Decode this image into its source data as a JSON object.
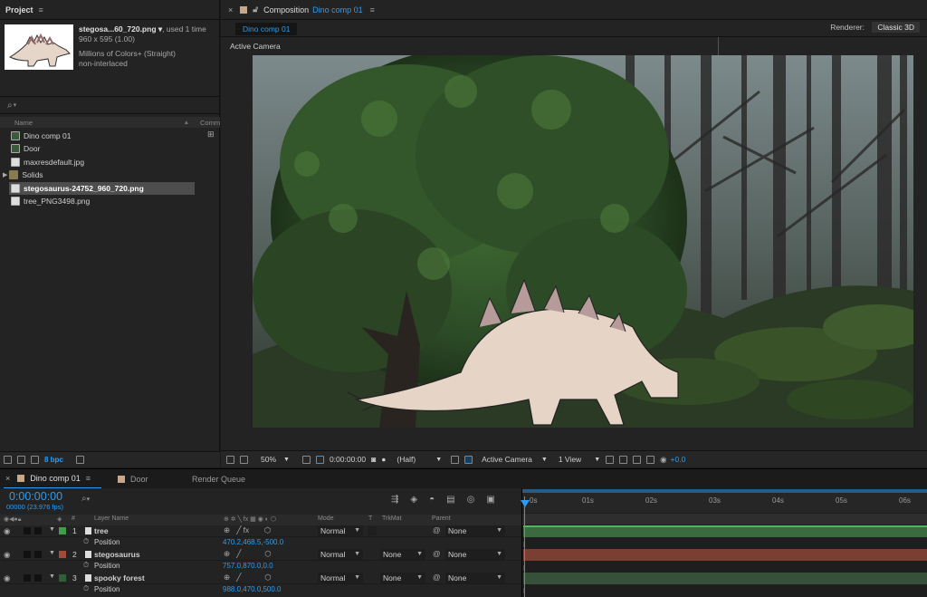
{
  "project": {
    "tab_label": "Project",
    "menu_icon": "≡",
    "file_name": "stegosa...60_720.png ▾",
    "file_used": ", used 1 time",
    "file_dims": "960 x 595 (1.00)",
    "file_colors": "Millions of Colors+ (Straight)",
    "file_interlace": "non-interlaced",
    "search_icon": "⌕",
    "col_name": "Name",
    "col_comment": "Comm",
    "items": [
      {
        "label": "Dino comp 01",
        "icon": "composition-icon"
      },
      {
        "label": "Door",
        "icon": "file-icon"
      },
      {
        "label": "maxresdefault.jpg",
        "icon": "file-icon"
      },
      {
        "label": "Solids",
        "icon": "folder-icon"
      },
      {
        "label": "stegosaurus-24752_960_720.png",
        "icon": "file-icon"
      },
      {
        "label": "tree_PNG3498.png",
        "icon": "file-icon"
      }
    ],
    "bpc_label": "8 bpc"
  },
  "composition": {
    "close": "×",
    "tab_prefix": "Composition",
    "tab_name": "Dino comp 01",
    "sub_tab": "Dino comp 01",
    "renderer_label": "Renderer:",
    "renderer_value": "Classic 3D",
    "active_camera": "Active Camera",
    "toolbar": {
      "zoom": "50%",
      "timecode": "0:00:00:00",
      "resolution": "(Half)",
      "camera": "Active Camera",
      "views": "1 View",
      "exposure": "+0.0"
    }
  },
  "timeline": {
    "tabs": [
      {
        "label": "Dino comp 01",
        "color": "#c8a78a"
      },
      {
        "label": "Door",
        "color": "#c8a78a"
      },
      {
        "label": "Render Queue",
        "color": ""
      }
    ],
    "timecode": "0:00:00:00",
    "fps": "00000 (23.976 fps)",
    "columns": {
      "hash": "#",
      "layer_name": "Layer Name",
      "mode": "Mode",
      "t": "T",
      "trkmat": "TrkMat",
      "parent": "Parent"
    },
    "layers": [
      {
        "num": "1",
        "name": "tree",
        "color": "#3f9d4a",
        "mode": "Normal",
        "trkmat": "",
        "parent": "None",
        "prop": "Position",
        "value": "470.2,468.5,-500.0",
        "bar_color": "#3b6a3e"
      },
      {
        "num": "2",
        "name": "stegosaurus",
        "color": "#a04a3a",
        "mode": "Normal",
        "trkmat": "None",
        "parent": "None",
        "prop": "Position",
        "value": "757.0,870.0,0.0",
        "bar_color": "#7a3e32"
      },
      {
        "num": "3",
        "name": "spooky forest",
        "color": "#2f5e38",
        "mode": "Normal",
        "trkmat": "None",
        "parent": "None",
        "prop": "Position",
        "value": "988.0,470.0,500.0",
        "bar_color": "#37503a"
      }
    ],
    "ruler": [
      "0s",
      "01s",
      "02s",
      "03s",
      "04s",
      "05s",
      "06s"
    ]
  }
}
